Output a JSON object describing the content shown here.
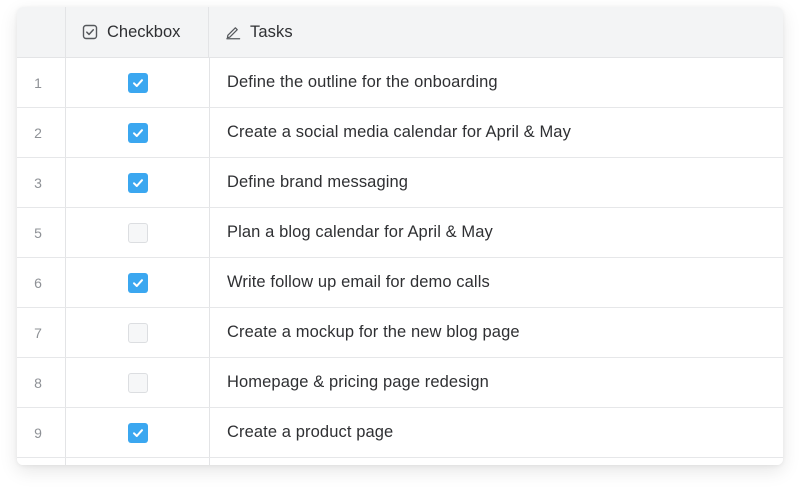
{
  "columns": {
    "checkbox_label": "Checkbox",
    "tasks_label": "Tasks",
    "checkbox_icon": "checkbox-icon",
    "tasks_icon": "pencil-icon"
  },
  "colors": {
    "checked": "#3ba7f0",
    "header_bg": "#f3f4f5",
    "row_number_text": "#8e9196"
  },
  "rows": [
    {
      "number": "1",
      "checked": true,
      "task": "Define the outline for the onboarding"
    },
    {
      "number": "2",
      "checked": true,
      "task": "Create a social media calendar for April & May"
    },
    {
      "number": "3",
      "checked": true,
      "task": "Define brand messaging"
    },
    {
      "number": "5",
      "checked": false,
      "task": "Plan a blog calendar for April & May"
    },
    {
      "number": "6",
      "checked": true,
      "task": "Write follow up email for demo calls"
    },
    {
      "number": "7",
      "checked": false,
      "task": "Create a mockup for the new blog page"
    },
    {
      "number": "8",
      "checked": false,
      "task": "Homepage & pricing page redesign"
    },
    {
      "number": "9",
      "checked": true,
      "task": "Create a product page"
    }
  ]
}
